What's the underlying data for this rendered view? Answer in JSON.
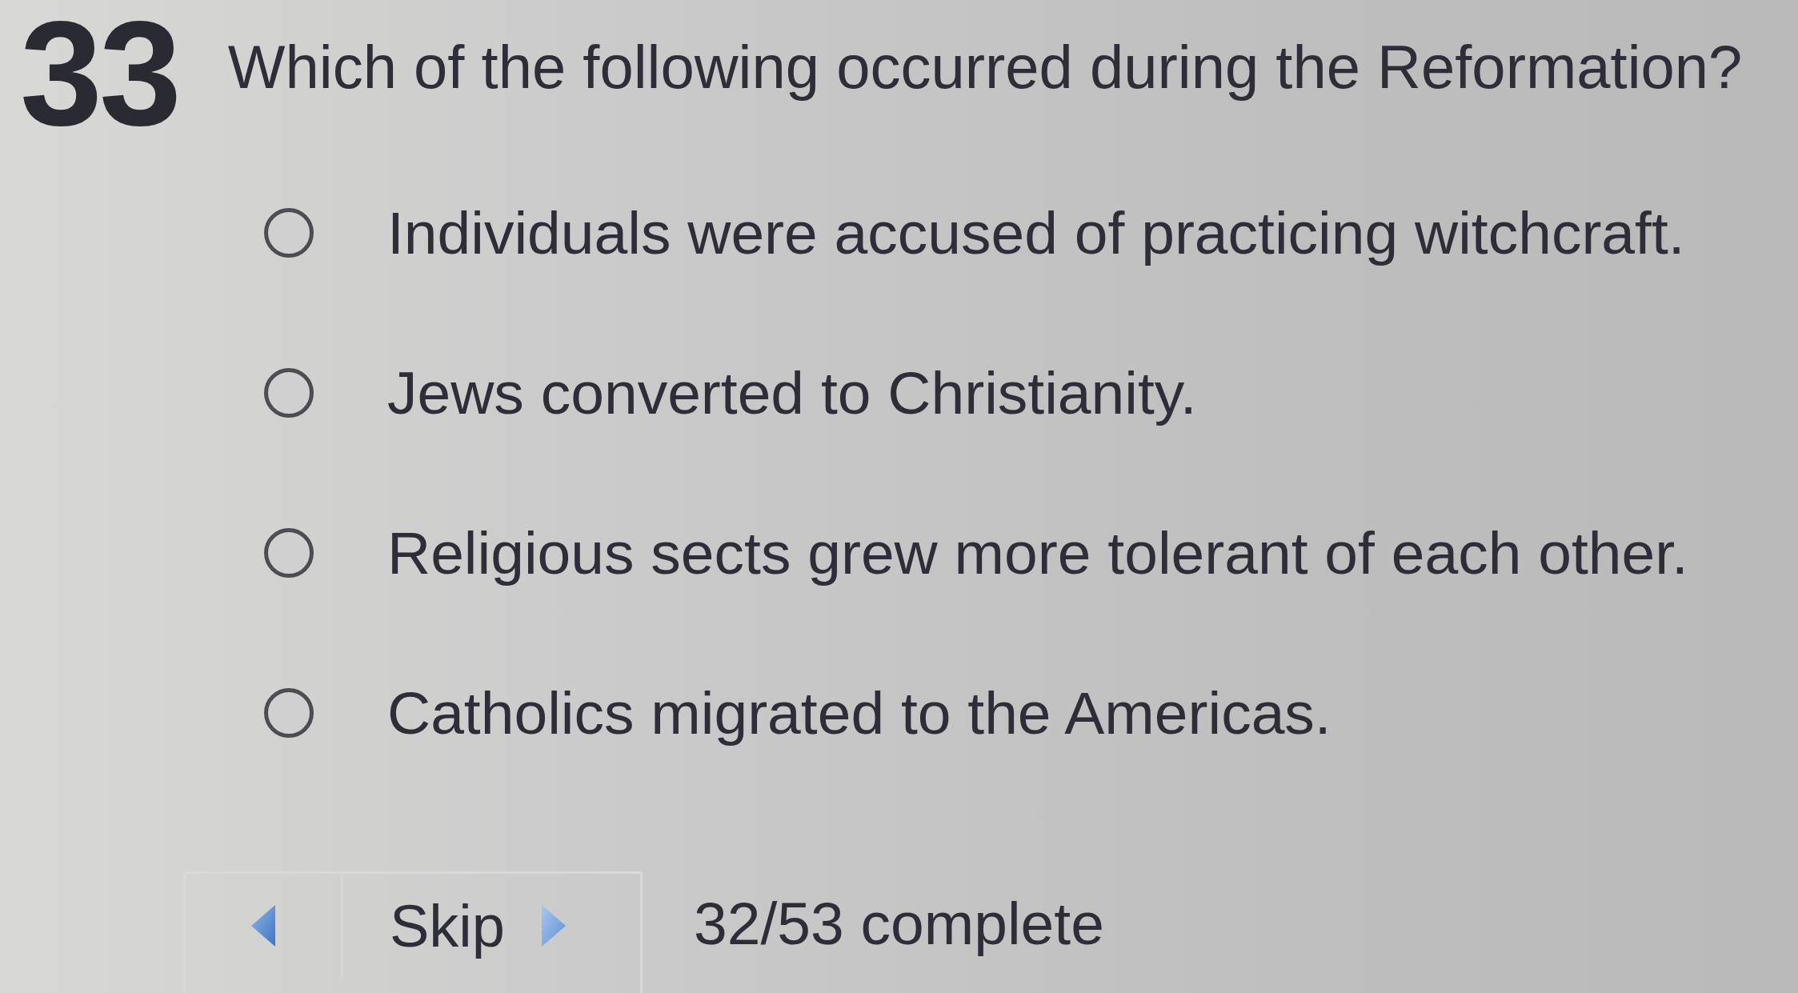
{
  "question": {
    "number": "33",
    "text": "Which of the following occurred during the Reformation?"
  },
  "options": [
    {
      "label": "Individuals were accused of practicing witchcraft.",
      "selected": false
    },
    {
      "label": "Jews converted to Christianity.",
      "selected": false
    },
    {
      "label": "Religious sects grew more tolerant of each other.",
      "selected": false
    },
    {
      "label": "Catholics migrated to the Americas.",
      "selected": false
    }
  ],
  "navigation": {
    "skip_label": "Skip",
    "progress": "32/53 complete"
  }
}
